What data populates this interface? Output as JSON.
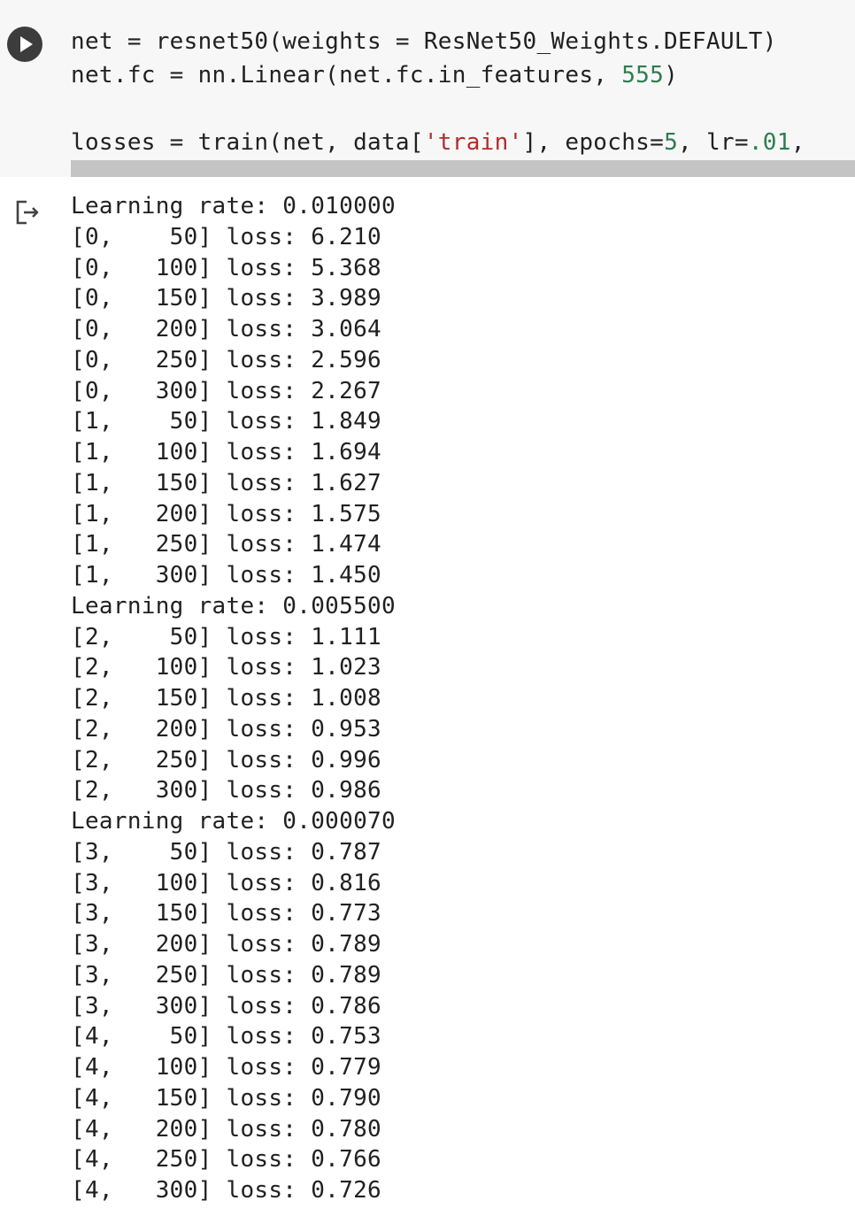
{
  "code": {
    "line1": {
      "text": "net = resnet50(weights = ResNet50_Weights.DEFAULT)"
    },
    "line2": {
      "pre": "net.fc = nn.Linear(net.fc.in_features, ",
      "num": "555",
      "post": ")"
    },
    "line3": {
      "pre": "losses = train(net, data[",
      "str": "'train'",
      "mid": "], epochs=",
      "num1": "5",
      "mid2": ", lr=",
      "num2": ".01",
      "post": ","
    }
  },
  "output": {
    "lines": [
      "Learning rate: 0.010000",
      "[0,    50] loss: 6.210",
      "[0,   100] loss: 5.368",
      "[0,   150] loss: 3.989",
      "[0,   200] loss: 3.064",
      "[0,   250] loss: 2.596",
      "[0,   300] loss: 2.267",
      "[1,    50] loss: 1.849",
      "[1,   100] loss: 1.694",
      "[1,   150] loss: 1.627",
      "[1,   200] loss: 1.575",
      "[1,   250] loss: 1.474",
      "[1,   300] loss: 1.450",
      "Learning rate: 0.005500",
      "[2,    50] loss: 1.111",
      "[2,   100] loss: 1.023",
      "[2,   150] loss: 1.008",
      "[2,   200] loss: 0.953",
      "[2,   250] loss: 0.996",
      "[2,   300] loss: 0.986",
      "Learning rate: 0.000070",
      "[3,    50] loss: 0.787",
      "[3,   100] loss: 0.816",
      "[3,   150] loss: 0.773",
      "[3,   200] loss: 0.789",
      "[3,   250] loss: 0.789",
      "[3,   300] loss: 0.786",
      "[4,    50] loss: 0.753",
      "[4,   100] loss: 0.779",
      "[4,   150] loss: 0.790",
      "[4,   200] loss: 0.780",
      "[4,   250] loss: 0.766",
      "[4,   300] loss: 0.726"
    ]
  },
  "icons": {
    "run": "play-icon",
    "output": "output-arrow-icon"
  },
  "colors": {
    "number": "#2e7d4f",
    "string": "#b22c2c",
    "cell_background": "#f7f7f7",
    "run_button": "#3c3c3c"
  }
}
